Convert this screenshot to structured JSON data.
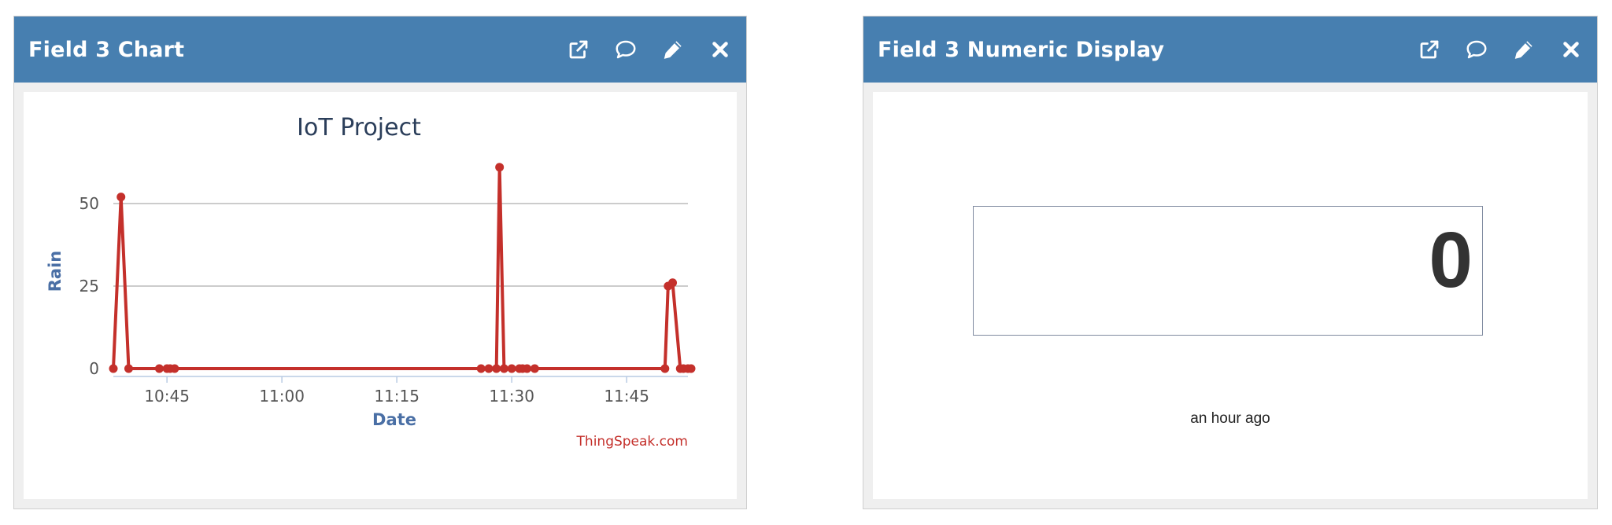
{
  "colors": {
    "header_bg": "#477fb0",
    "series": "#c4302b",
    "title": "#2b3e5a",
    "axis_label": "#4a6fa5",
    "credits": "#c4302b"
  },
  "widgets": [
    {
      "title": "Field 3 Chart",
      "icons": [
        "external-link-icon",
        "comment-icon",
        "pencil-icon",
        "close-icon"
      ]
    },
    {
      "title": "Field 3 Numeric Display",
      "icons": [
        "external-link-icon",
        "comment-icon",
        "pencil-icon",
        "close-icon"
      ]
    }
  ],
  "chart_data": {
    "type": "line",
    "title": "IoT Project",
    "xlabel": "Date",
    "ylabel": "Rain",
    "credits": "ThingSpeak.com",
    "x_ticks": [
      "10:45",
      "11:00",
      "11:15",
      "11:30",
      "11:45"
    ],
    "y_ticks": [
      0,
      25,
      50
    ],
    "grid": true,
    "legend": false,
    "xlim": [
      "10:38",
      "11:53"
    ],
    "ylim": [
      0,
      60
    ],
    "series": [
      {
        "points": [
          [
            "10:38",
            0
          ],
          [
            "10:39",
            52
          ],
          [
            "10:40",
            0
          ],
          [
            "10:44",
            0
          ],
          [
            "10:45",
            0
          ],
          [
            "10:45",
            0
          ],
          [
            "10:46",
            0
          ],
          [
            "11:26",
            0
          ],
          [
            "11:27",
            0
          ],
          [
            "11:28",
            0
          ],
          [
            "11:28",
            61
          ],
          [
            "11:29",
            0
          ],
          [
            "11:30",
            0
          ],
          [
            "11:31",
            0
          ],
          [
            "11:31",
            0
          ],
          [
            "11:32",
            0
          ],
          [
            "11:33",
            0
          ],
          [
            "11:50",
            0
          ],
          [
            "11:50",
            25
          ],
          [
            "11:51",
            26
          ],
          [
            "11:52",
            0
          ],
          [
            "11:52",
            0
          ],
          [
            "11:53",
            0
          ],
          [
            "11:53",
            0
          ]
        ]
      }
    ]
  },
  "numeric_display": {
    "value": "0",
    "updated": "an hour ago"
  }
}
